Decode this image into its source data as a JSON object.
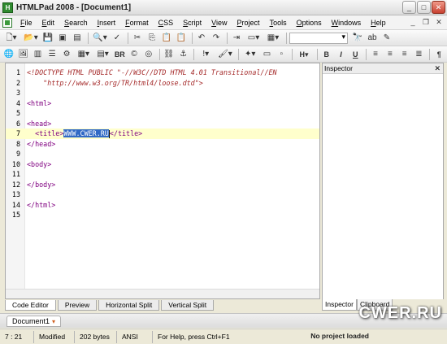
{
  "window": {
    "title": "HTMLPad 2008 - [Document1]",
    "app_icon": "H"
  },
  "menubar": {
    "items": [
      "File",
      "Edit",
      "Search",
      "Insert",
      "Format",
      "CSS",
      "Script",
      "View",
      "Project",
      "Tools",
      "Options",
      "Windows",
      "Help"
    ]
  },
  "toolbar2": {
    "br_label": "BR",
    "bold_label": "B",
    "italic_label": "I",
    "underline_label": "U",
    "pilcrow_label": "¶",
    "h_label": "H"
  },
  "editor": {
    "lines": [
      {
        "num": "1",
        "text": "<!DOCTYPE HTML PUBLIC \"-//W3C//DTD HTML 4.01 Transitional//EN",
        "kind": "doctype"
      },
      {
        "num": "2",
        "text": "    \"http://www.w3.org/TR/html4/loose.dtd\">",
        "kind": "doctype"
      },
      {
        "num": "3",
        "text": "",
        "kind": "plain"
      },
      {
        "num": "4",
        "text": "<html>",
        "kind": "tag"
      },
      {
        "num": "5",
        "text": "",
        "kind": "plain"
      },
      {
        "num": "6",
        "text": "<head>",
        "kind": "tag"
      },
      {
        "num": "7",
        "text": "  <title>WWW.CWER.RU</title>",
        "kind": "title"
      },
      {
        "num": "8",
        "text": "</head>",
        "kind": "tag"
      },
      {
        "num": "9",
        "text": "",
        "kind": "plain"
      },
      {
        "num": "10",
        "text": "<body>",
        "kind": "tag"
      },
      {
        "num": "11",
        "text": "",
        "kind": "plain"
      },
      {
        "num": "12",
        "text": "</body>",
        "kind": "tag"
      },
      {
        "num": "13",
        "text": "",
        "kind": "plain"
      },
      {
        "num": "14",
        "text": "</html>",
        "kind": "tag"
      },
      {
        "num": "15",
        "text": "",
        "kind": "plain"
      }
    ],
    "title_open": "  <title>",
    "title_selected": "WWW.CWER.RU",
    "title_close": "</title>"
  },
  "mode_tabs": [
    "Code Editor",
    "Preview",
    "Horizontal Split",
    "Vertical Split"
  ],
  "inspector": {
    "header": "Inspector",
    "tabs": [
      "Inspector",
      "Clipboard"
    ]
  },
  "document_tab": {
    "label": "Document1"
  },
  "statusbar": {
    "position": "7 : 21",
    "state": "Modified",
    "size": "202 bytes",
    "encoding": "ANSI",
    "help": "For Help, press Ctrl+F1",
    "project": "No project loaded"
  },
  "watermark": "CWER.RU",
  "colors": {
    "selection": "#316ac5",
    "current_line": "#ffffcc",
    "tag": "#800080",
    "doctype": "#a52a2a"
  }
}
